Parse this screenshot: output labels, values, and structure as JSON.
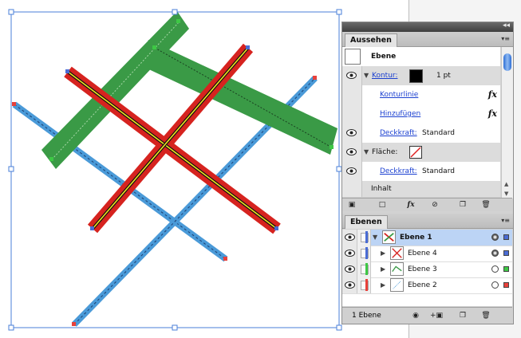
{
  "appearance_panel": {
    "tab_label": "Aussehen",
    "object_label": "Ebene",
    "stroke_label": "Kontur:",
    "stroke_value": "1 pt",
    "stroke_color": "#000000",
    "sub_items": [
      "Konturlinie",
      "Hinzufügen"
    ],
    "opacity_label": "Deckkraft:",
    "opacity_value": "Standard",
    "fill_label": "Fläche:",
    "fill_opacity_label": "Deckkraft:",
    "fill_opacity_value": "Standard",
    "contents_label": "Inhalt",
    "fx_label": "fx"
  },
  "layers_panel": {
    "tab_label": "Ebenen",
    "layers": [
      {
        "name": "Ebene 1",
        "color": "#4a6cd4",
        "selected": true
      },
      {
        "name": "Ebene 4",
        "color": "#4a6cd4",
        "selected": false
      },
      {
        "name": "Ebene 3",
        "color": "#3ec845",
        "selected": false
      },
      {
        "name": "Ebene 2",
        "color": "#e8413b",
        "selected": false
      }
    ],
    "status": "1 Ebene"
  },
  "colors": {
    "green_stroke": "#3a9a46",
    "red_stroke": "#d6231f",
    "blue_stroke": "#4a9ad8",
    "selection": "#4a7fd8"
  }
}
